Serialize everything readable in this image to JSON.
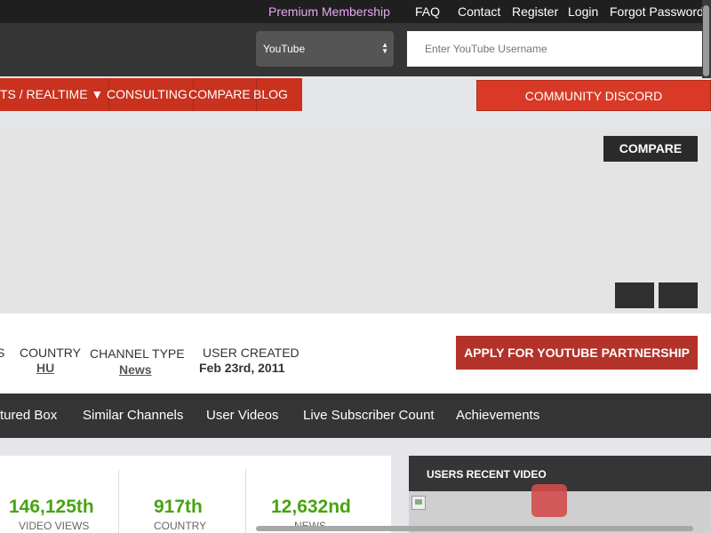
{
  "topbar": {
    "premium": "Premium Membership",
    "faq": "FAQ",
    "contact": "Contact",
    "register": "Register",
    "login": "Login",
    "forgot": "Forgot Password?"
  },
  "search": {
    "platform": "YouTube",
    "placeholder": "Enter YouTube Username"
  },
  "nav": {
    "items": [
      "TS / REALTIME ▼",
      "CONSULTING",
      "COMPARE",
      "BLOG"
    ],
    "discord": "COMMUNITY DISCORD"
  },
  "banner": {
    "compare": "COMPARE"
  },
  "info": {
    "partial_label": "S",
    "country_label": "COUNTRY",
    "country_value": "HU",
    "channel_type_label": "CHANNEL TYPE",
    "channel_type_value": "News",
    "user_created_label": "USER CREATED",
    "user_created_value": "Feb 23rd, 2011",
    "partner_button": "APPLY FOR YOUTUBE PARTNERSHIP"
  },
  "tabs": [
    "tured Box",
    "Similar Channels",
    "User Videos",
    "Live Subscriber Count",
    "Achievements"
  ],
  "stats": [
    {
      "value": "146,125th",
      "label": "VIDEO VIEWS"
    },
    {
      "value": "917th",
      "label": "COUNTRY"
    },
    {
      "value": "12,632nd",
      "label": "NEWS"
    }
  ],
  "video": {
    "heading": "USERS RECENT VIDEO"
  },
  "colors": {
    "accent_red": "#c8321f",
    "stat_green": "#47a310",
    "premium_pink": "#e8a6f3",
    "dark_bar": "#353535"
  }
}
